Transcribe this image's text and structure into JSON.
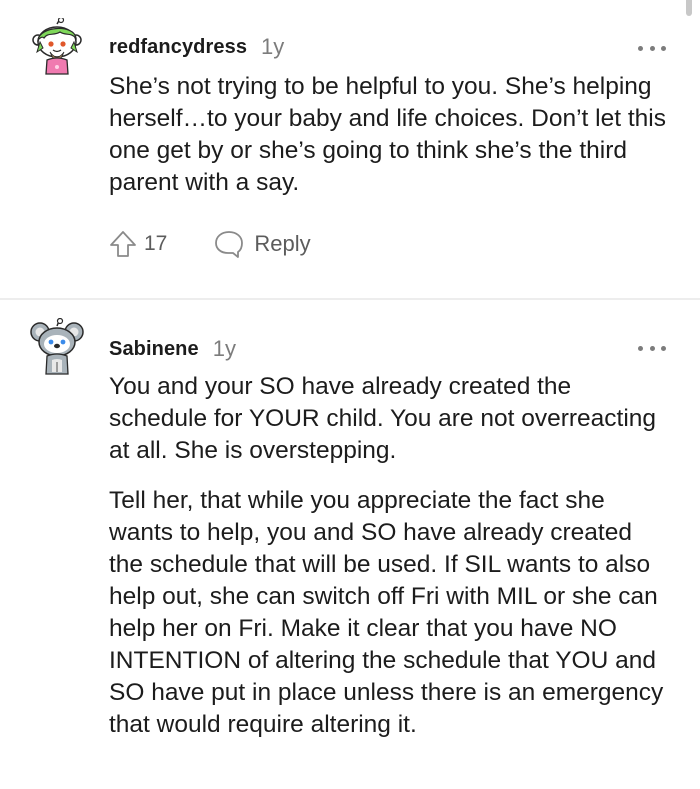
{
  "comments": [
    {
      "username": "redfancydress",
      "age": "1y",
      "avatar_icon": "snoo-avatar-green-hair-icon",
      "paragraphs": [
        "She’s not trying to be helpful to you. She’s helping herself…to your baby and life choices. Don’t let this one get by or she’s going to think she’s the third parent with a say."
      ],
      "vote_count": "17",
      "reply_label": "Reply"
    },
    {
      "username": "Sabinene",
      "age": "1y",
      "avatar_icon": "snoo-avatar-koala-icon",
      "paragraphs": [
        "You and your SO have already created the schedule for YOUR child. You are not overreacting at all. She is overstepping.",
        "Tell her, that while you appreciate the fact she wants to help, you and SO have already created the schedule that will be used. If SIL wants to also help out, she can switch off Fri with MIL or she can help her on Fri. Make it clear that you have NO INTENTION of altering the schedule that YOU and SO have put in place unless there is an emergency that would require altering it."
      ]
    }
  ],
  "colors": {
    "text": "#1c1c1c",
    "meta": "#7c7c7c",
    "action": "#5c5c5c",
    "divider": "#ededed"
  }
}
